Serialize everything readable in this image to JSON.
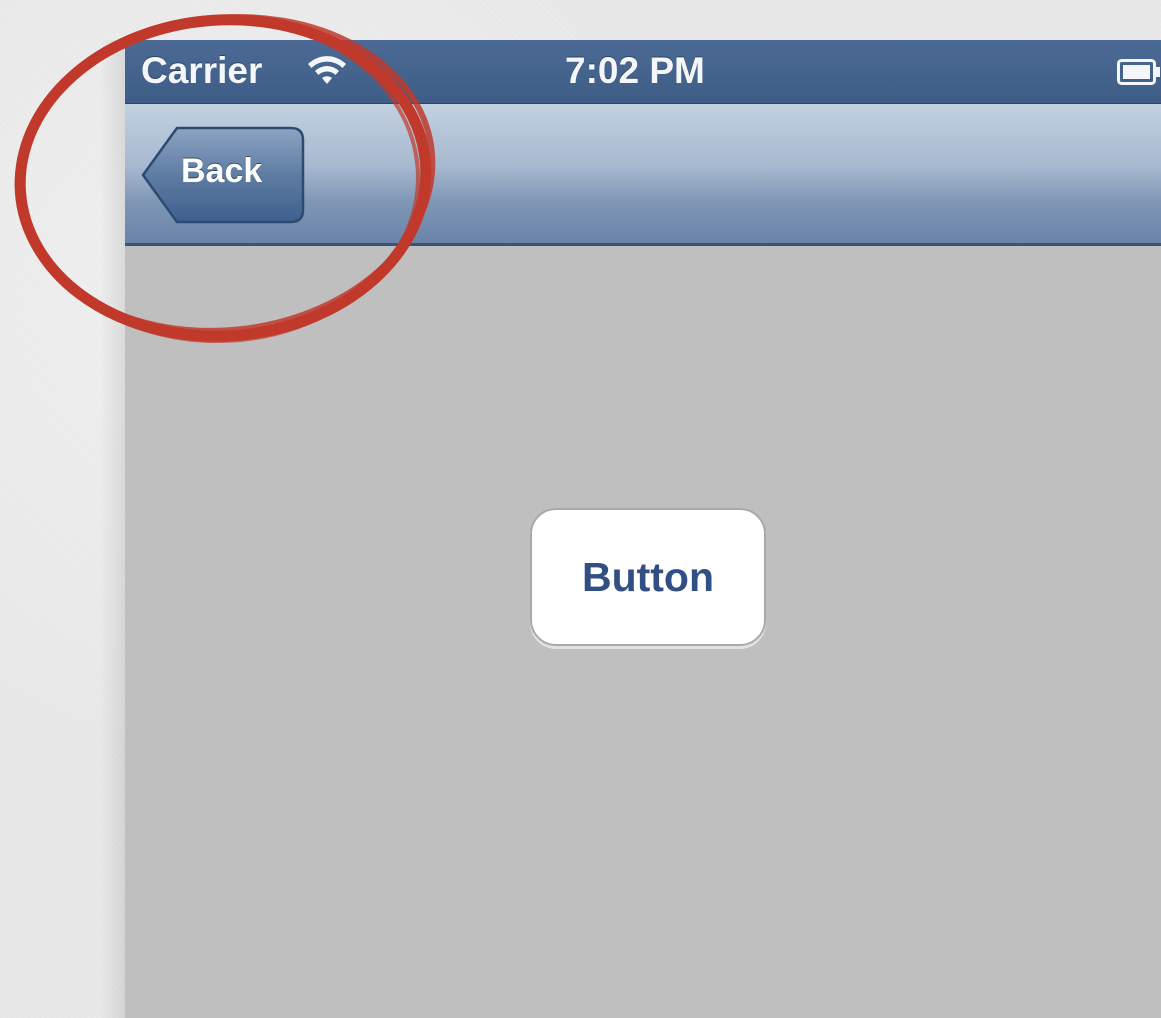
{
  "status_bar": {
    "carrier": "Carrier",
    "time": "7:02 PM",
    "wifi_icon": "wifi-icon",
    "battery_icon": "battery-icon"
  },
  "nav_bar": {
    "back_label": "Back"
  },
  "content": {
    "button_label": "Button"
  },
  "colors": {
    "status_bar": "#3d5d86",
    "nav_bar_top": "#c2d1e1",
    "nav_bar_bottom": "#6a84a8",
    "content_background": "#bfbfbf",
    "button_text": "#324f85",
    "annotation": "#c0392b"
  }
}
